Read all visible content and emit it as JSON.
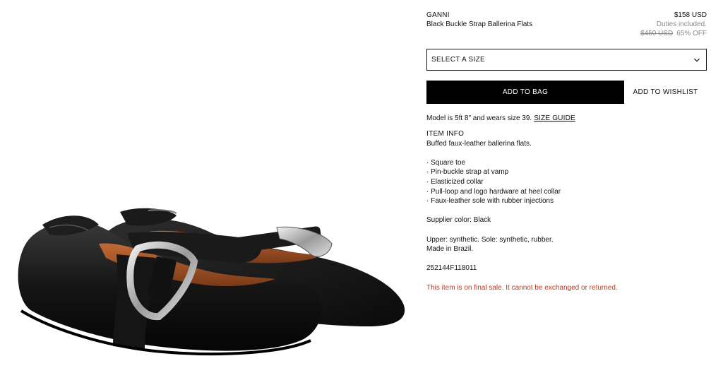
{
  "product": {
    "brand": "GANNI",
    "name": "Black Buckle Strap Ballerina Flats",
    "price": "$158 USD",
    "duties": "Duties included.",
    "original_price": "$450 USD",
    "discount": "65% OFF"
  },
  "size_select": {
    "label": "SELECT A SIZE"
  },
  "actions": {
    "add_to_bag": "ADD TO BAG",
    "add_to_wishlist": "ADD TO WISHLIST"
  },
  "model_note": {
    "text": "Model is 5ft 8\" and wears size 39.",
    "size_guide": "SIZE GUIDE"
  },
  "item_info": {
    "title": "ITEM INFO",
    "description": "Buffed faux-leather ballerina flats.",
    "features": [
      "· Square toe",
      "· Pin-buckle strap at vamp",
      "· Elasticized collar",
      "· Pull-loop and logo hardware at heel collar",
      "· Faux-leather sole with rubber injections"
    ],
    "supplier_color": "Supplier color: Black",
    "materials": "Upper: synthetic. Sole: synthetic, rubber.",
    "origin": "Made in Brazil.",
    "sku": "252144F118011",
    "final_sale": "This item is on final sale. It cannot be exchanged or returned."
  },
  "colors": {
    "accent": "#000000",
    "final_sale": "#c4371c",
    "muted": "#8a8a8a"
  },
  "icons": {
    "size_select": "chevron-down-icon"
  }
}
